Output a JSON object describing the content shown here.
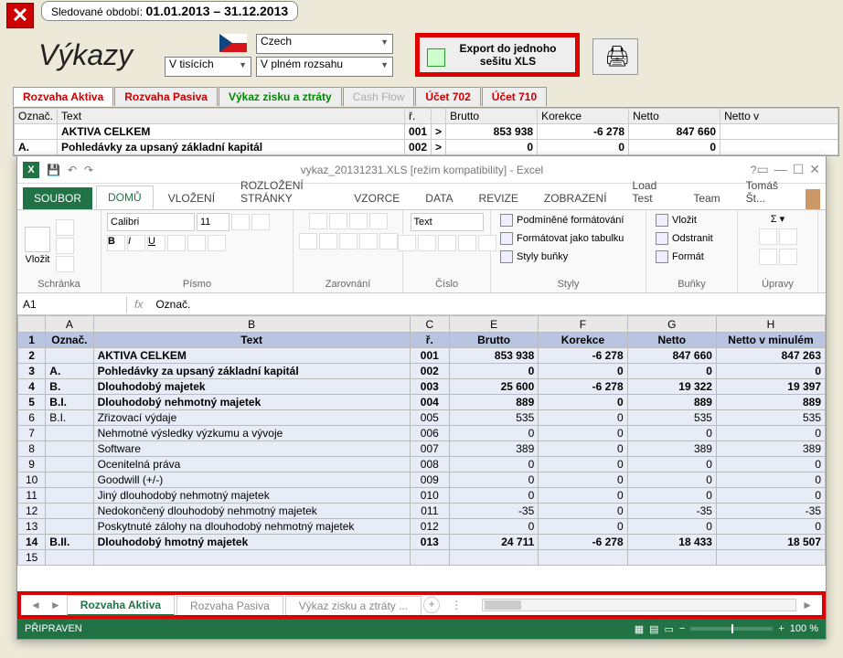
{
  "period": {
    "label": "Sledované období:",
    "value": "01.01.2013 – 31.12.2013"
  },
  "title": "Výkazy",
  "selects": {
    "lang": "Czech",
    "units": "V tisících",
    "scope": "V plném rozsahu"
  },
  "export_btn": "Export do jednoho sešitu XLS",
  "app_tabs": [
    "Rozvaha Aktiva",
    "Rozvaha Pasiva",
    "Výkaz zisku a ztráty",
    "Cash Flow",
    "Účet 702",
    "Účet 710"
  ],
  "app_cols": [
    "Označ.",
    "Text",
    "ř.",
    "",
    "Brutto",
    "Korekce",
    "Netto",
    "Netto v"
  ],
  "app_rows": [
    {
      "o": "",
      "t": "AKTIVA CELKEM",
      "r": "001",
      "b": "853 938",
      "k": "-6 278",
      "n": "847 660",
      "bold": true
    },
    {
      "o": "A.",
      "t": "Pohledávky za upsaný základní kapitál",
      "r": "002",
      "b": "0",
      "k": "0",
      "n": "0",
      "bold": true
    }
  ],
  "excel": {
    "filename": "vykaz_20131231.XLS  [režim kompatibility] - Excel",
    "username": "Tomáš Št...",
    "tabs": [
      "SOUBOR",
      "DOMŮ",
      "VLOŽENÍ",
      "ROZLOŽENÍ STRÁNKY",
      "VZORCE",
      "DATA",
      "REVIZE",
      "ZOBRAZENÍ",
      "Load Test",
      "Team"
    ],
    "groups": {
      "clip": "Schránka",
      "font": "Písmo",
      "align": "Zarovnání",
      "num": "Číslo",
      "styles": "Styly",
      "cells": "Buňky",
      "edit": "Úpravy"
    },
    "paste": "Vložit",
    "font": "Calibri",
    "size": "11",
    "numfmt": "Text",
    "style_btns": [
      "Podmíněné formátování",
      "Formátovat jako tabulku",
      "Styly buňky"
    ],
    "cell_btns": [
      "Vložit",
      "Odstranit",
      "Formát"
    ],
    "namebox": "A1",
    "formula": "Označ.",
    "cols": [
      "",
      "A",
      "B",
      "C",
      "E",
      "F",
      "G",
      "H"
    ],
    "hdr": [
      "Označ.",
      "Text",
      "ř.",
      "Brutto",
      "Korekce",
      "Netto",
      "Netto v minulém"
    ],
    "rows": [
      {
        "n": 2,
        "o": "",
        "t": "AKTIVA CELKEM",
        "r": "001",
        "b": "853 938",
        "k": "-6 278",
        "ne": "847 660",
        "nm": "847 263",
        "bold": true
      },
      {
        "n": 3,
        "o": "A.",
        "t": "Pohledávky za upsaný základní kapitál",
        "r": "002",
        "b": "0",
        "k": "0",
        "ne": "0",
        "nm": "0",
        "bold": true
      },
      {
        "n": 4,
        "o": "B.",
        "t": "Dlouhodobý majetek",
        "r": "003",
        "b": "25 600",
        "k": "-6 278",
        "ne": "19 322",
        "nm": "19 397",
        "bold": true
      },
      {
        "n": 5,
        "o": "B.I.",
        "t": "Dlouhodobý nehmotný majetek",
        "r": "004",
        "b": "889",
        "k": "0",
        "ne": "889",
        "nm": "889",
        "bold": true
      },
      {
        "n": 6,
        "o": "B.I.",
        "t": "Zřizovací výdaje",
        "r": "005",
        "b": "535",
        "k": "0",
        "ne": "535",
        "nm": "535"
      },
      {
        "n": 7,
        "o": "",
        "t": "Nehmotné výsledky výzkumu a vývoje",
        "r": "006",
        "b": "0",
        "k": "0",
        "ne": "0",
        "nm": "0"
      },
      {
        "n": 8,
        "o": "",
        "t": "Software",
        "r": "007",
        "b": "389",
        "k": "0",
        "ne": "389",
        "nm": "389"
      },
      {
        "n": 9,
        "o": "",
        "t": "Ocenitelná práva",
        "r": "008",
        "b": "0",
        "k": "0",
        "ne": "0",
        "nm": "0"
      },
      {
        "n": 10,
        "o": "",
        "t": "Goodwill (+/-)",
        "r": "009",
        "b": "0",
        "k": "0",
        "ne": "0",
        "nm": "0"
      },
      {
        "n": 11,
        "o": "",
        "t": "Jiný dlouhodobý nehmotný majetek",
        "r": "010",
        "b": "0",
        "k": "0",
        "ne": "0",
        "nm": "0"
      },
      {
        "n": 12,
        "o": "",
        "t": "Nedokončený dlouhodobý nehmotný majetek",
        "r": "011",
        "b": "-35",
        "k": "0",
        "ne": "-35",
        "nm": "-35"
      },
      {
        "n": 13,
        "o": "",
        "t": "Poskytnuté zálohy na dlouhodobý nehmotný majetek",
        "r": "012",
        "b": "0",
        "k": "0",
        "ne": "0",
        "nm": "0"
      },
      {
        "n": 14,
        "o": "B.II.",
        "t": "Dlouhodobý hmotný majetek",
        "r": "013",
        "b": "24 711",
        "k": "-6 278",
        "ne": "18 433",
        "nm": "18 507",
        "bold": true
      },
      {
        "n": 15,
        "o": "",
        "t": "",
        "r": "",
        "b": "",
        "k": "",
        "ne": "",
        "nm": ""
      }
    ],
    "sheets": [
      "Rozvaha Aktiva",
      "Rozvaha Pasiva",
      "Výkaz zisku a ztráty  ..."
    ],
    "status": "PŘIPRAVEN",
    "zoom": "100 %"
  }
}
